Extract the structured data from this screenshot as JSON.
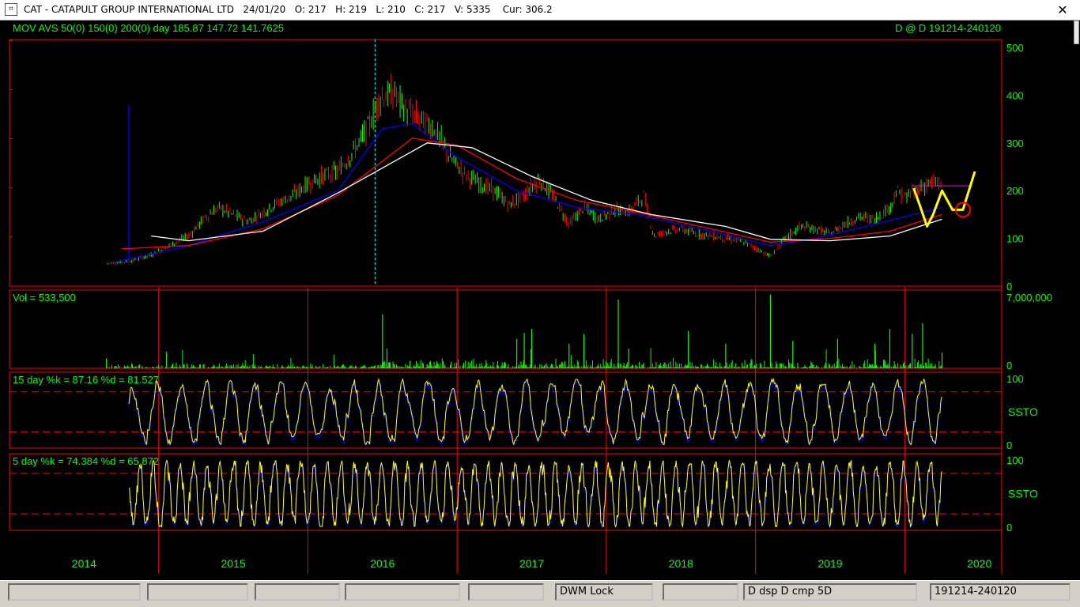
{
  "window": {
    "title": "CAT - CATAPULT GROUP INTERNATIONAL LTD   24/01/20   O: 217   H: 219   L: 210   C: 217   V: 5335    Cur: 306.2",
    "close_glyph": "✕",
    "app_icon": "chart-app-icon"
  },
  "statusbar": {
    "cells": [
      "",
      "",
      "",
      "",
      "",
      "DWM Lock",
      "",
      "D dsp D cmp     5D",
      "191214-240120"
    ]
  },
  "chart_data": [
    {
      "type": "candlestick",
      "title": "MOV AVS 50(0) 150(0) 200(0)  day      185.87  147.72  141.7625",
      "right_label": "D @ D   191214-240120",
      "y_ticks": [
        "500",
        "400",
        "300",
        "200",
        "100",
        "0"
      ],
      "ylim": [
        0,
        500
      ],
      "x_labels": [
        "2014",
        "2015",
        "2016",
        "2017",
        "2018",
        "2019",
        "2020"
      ],
      "price_path": [
        [
          2014.45,
          48
        ],
        [
          2014.6,
          52
        ],
        [
          2014.75,
          65
        ],
        [
          2014.9,
          90
        ],
        [
          2015.0,
          105
        ],
        [
          2015.1,
          140
        ],
        [
          2015.2,
          165
        ],
        [
          2015.3,
          150
        ],
        [
          2015.4,
          135
        ],
        [
          2015.5,
          155
        ],
        [
          2015.6,
          175
        ],
        [
          2015.7,
          190
        ],
        [
          2015.8,
          215
        ],
        [
          2015.9,
          230
        ],
        [
          2016.0,
          240
        ],
        [
          2016.1,
          280
        ],
        [
          2016.2,
          330
        ],
        [
          2016.28,
          395
        ],
        [
          2016.38,
          405
        ],
        [
          2016.45,
          370
        ],
        [
          2016.55,
          350
        ],
        [
          2016.65,
          330
        ],
        [
          2016.75,
          270
        ],
        [
          2016.85,
          235
        ],
        [
          2016.95,
          215
        ],
        [
          2017.05,
          200
        ],
        [
          2017.15,
          170
        ],
        [
          2017.25,
          190
        ],
        [
          2017.35,
          225
        ],
        [
          2017.45,
          185
        ],
        [
          2017.55,
          130
        ],
        [
          2017.65,
          165
        ],
        [
          2017.75,
          140
        ],
        [
          2017.85,
          160
        ],
        [
          2017.95,
          155
        ],
        [
          2018.05,
          190
        ],
        [
          2018.12,
          105
        ],
        [
          2018.2,
          115
        ],
        [
          2018.3,
          120
        ],
        [
          2018.4,
          110
        ],
        [
          2018.5,
          105
        ],
        [
          2018.6,
          100
        ],
        [
          2018.7,
          95
        ],
        [
          2018.8,
          80
        ],
        [
          2018.9,
          62
        ],
        [
          2019.0,
          100
        ],
        [
          2019.1,
          125
        ],
        [
          2019.2,
          120
        ],
        [
          2019.3,
          110
        ],
        [
          2019.4,
          130
        ],
        [
          2019.5,
          145
        ],
        [
          2019.6,
          140
        ],
        [
          2019.7,
          165
        ],
        [
          2019.75,
          200
        ],
        [
          2019.8,
          185
        ],
        [
          2019.9,
          205
        ],
        [
          2019.96,
          215
        ],
        [
          2020.05,
          217
        ]
      ],
      "series": [
        {
          "name": "MA 50",
          "color": "#0000ff",
          "values": [
            [
              2014.5,
              50
            ],
            [
              2015.0,
              85
            ],
            [
              2015.5,
              135
            ],
            [
              2016.0,
              200
            ],
            [
              2016.3,
              330
            ],
            [
              2016.5,
              340
            ],
            [
              2016.8,
              270
            ],
            [
              2017.2,
              200
            ],
            [
              2017.6,
              165
            ],
            [
              2018.0,
              150
            ],
            [
              2018.5,
              115
            ],
            [
              2018.9,
              85
            ],
            [
              2019.2,
              100
            ],
            [
              2019.6,
              130
            ],
            [
              2020.05,
              165
            ]
          ]
        },
        {
          "name": "MA 150",
          "color": "#ff0000",
          "values": [
            [
              2014.55,
              78
            ],
            [
              2015.0,
              85
            ],
            [
              2015.5,
              120
            ],
            [
              2016.0,
              190
            ],
            [
              2016.5,
              310
            ],
            [
              2016.8,
              295
            ],
            [
              2017.2,
              225
            ],
            [
              2017.6,
              180
            ],
            [
              2018.0,
              155
            ],
            [
              2018.5,
              120
            ],
            [
              2018.9,
              92
            ],
            [
              2019.3,
              100
            ],
            [
              2019.7,
              115
            ],
            [
              2020.05,
              150
            ]
          ]
        },
        {
          "name": "MA 200",
          "color": "#ffffff",
          "values": [
            [
              2014.75,
              105
            ],
            [
              2015.0,
              95
            ],
            [
              2015.5,
              115
            ],
            [
              2016.0,
              195
            ],
            [
              2016.6,
              300
            ],
            [
              2016.9,
              290
            ],
            [
              2017.3,
              230
            ],
            [
              2017.7,
              180
            ],
            [
              2018.1,
              150
            ],
            [
              2018.6,
              125
            ],
            [
              2018.9,
              98
            ],
            [
              2019.3,
              95
            ],
            [
              2019.7,
              105
            ],
            [
              2020.05,
              140
            ]
          ]
        }
      ],
      "resistance_line": {
        "y": 210,
        "from": 2019.85,
        "to": 2020.25,
        "color": "#ff00ff"
      },
      "annotation_curve": [
        [
          2019.86,
          205
        ],
        [
          2019.9,
          170
        ],
        [
          2019.95,
          125
        ],
        [
          2019.99,
          150
        ],
        [
          2020.05,
          200
        ],
        [
          2020.12,
          160
        ],
        [
          2020.19,
          160
        ],
        [
          2020.27,
          240
        ]
      ],
      "annotation_circle": {
        "x": 2020.19,
        "y": 160
      },
      "blue_spike": {
        "x": 2014.6,
        "from": 55,
        "to": 380
      }
    },
    {
      "type": "bar",
      "title": "Vol = 533,500",
      "y_ticks": [
        "7,000,000",
        "0"
      ],
      "ylim": [
        0,
        7000000
      ],
      "spikes": [
        [
          2014.45,
          1000000
        ],
        [
          2016.3,
          5500000
        ],
        [
          2016.33,
          2000000
        ],
        [
          2017.2,
          3000000
        ],
        [
          2017.25,
          3600000
        ],
        [
          2017.3,
          4000000
        ],
        [
          2017.55,
          2500000
        ],
        [
          2017.65,
          3500000
        ],
        [
          2017.88,
          7000000
        ],
        [
          2017.95,
          2000000
        ],
        [
          2018.35,
          3800000
        ],
        [
          2018.6,
          2500000
        ],
        [
          2018.9,
          7500000
        ],
        [
          2019.05,
          2800000
        ],
        [
          2019.35,
          3000000
        ],
        [
          2019.6,
          2500000
        ],
        [
          2019.7,
          4000000
        ],
        [
          2019.85,
          3500000
        ],
        [
          2019.92,
          4600000
        ],
        [
          2020.05,
          1600000
        ]
      ]
    },
    {
      "type": "line",
      "title": "15 day   %k = 87.16   %d = 81.527",
      "side_label": "SSTO",
      "y_ticks": [
        "100",
        "0"
      ],
      "ylim": [
        0,
        100
      ],
      "guides": [
        80,
        20
      ]
    },
    {
      "type": "line",
      "title": "5 day   %k = 74.384   %d = 65.872",
      "side_label": "SSTO",
      "y_ticks": [
        "100",
        "0"
      ],
      "ylim": [
        0,
        100
      ],
      "guides": [
        80,
        20
      ]
    }
  ]
}
